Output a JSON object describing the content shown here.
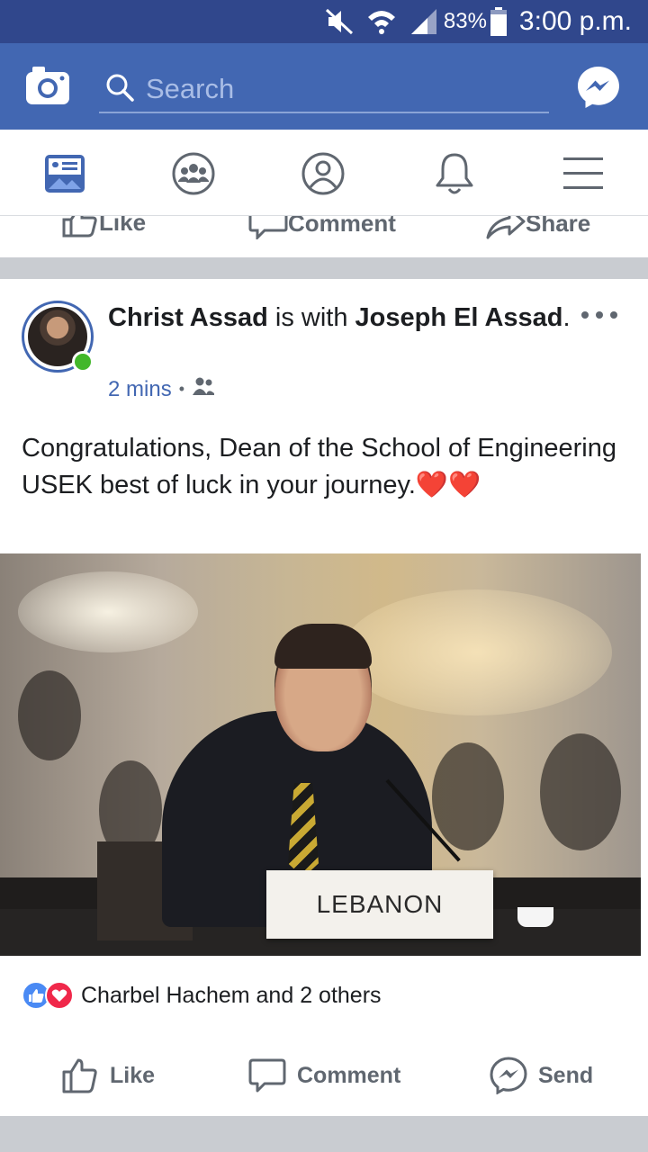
{
  "status_bar": {
    "battery": "83%",
    "time": "3:00 p.m.",
    "icons": [
      "mute-icon",
      "wifi-icon",
      "signal-icon",
      "battery-icon"
    ]
  },
  "app_bar": {
    "search_placeholder": "Search",
    "icons": [
      "camera-icon",
      "search-icon",
      "messenger-icon"
    ]
  },
  "nav_tabs": [
    "news-feed-icon",
    "groups-icon",
    "profile-icon",
    "notifications-icon",
    "menu-icon"
  ],
  "prev_post_actions": {
    "like": "Like",
    "comment": "Comment",
    "share": "Share"
  },
  "post": {
    "author": "Christ Assad",
    "with_text": " is with ",
    "tagged": "Joseph El Assad",
    "period": ".",
    "time": "2 mins",
    "audience_icon": "friends-icon",
    "text": "Congratulations, Dean of the School of Engineering USEK best of luck in your journey.",
    "hearts": "❤️❤️",
    "photo_label": "LEBANON",
    "reactions_text": "Charbel Hachem and 2 others",
    "actions": {
      "like": "Like",
      "comment": "Comment",
      "send": "Send"
    }
  },
  "colors": {
    "status_bar": "#30478c",
    "app_bar": "#4267b2",
    "nav_active": "#4267b2",
    "divider": "#c9ccd1",
    "online": "#42b72a"
  }
}
